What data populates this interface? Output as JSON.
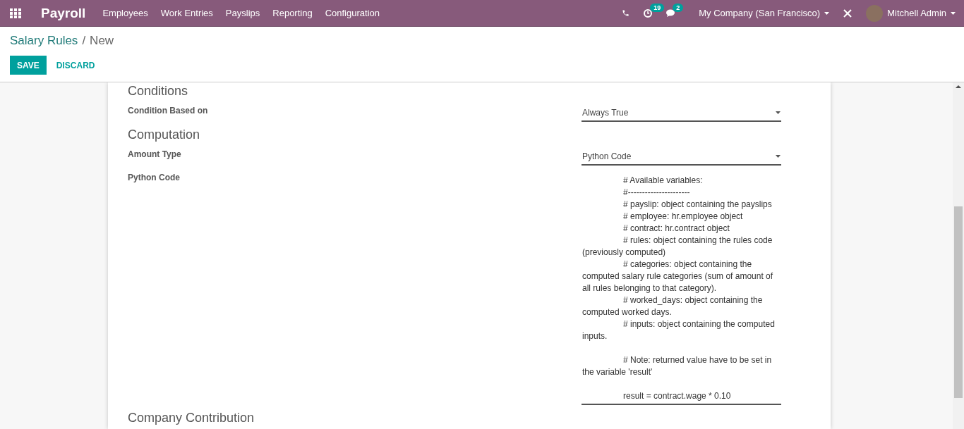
{
  "navbar": {
    "app_title": "Payroll",
    "menu": [
      "Employees",
      "Work Entries",
      "Payslips",
      "Reporting",
      "Configuration"
    ],
    "activity_count": "19",
    "message_count": "2",
    "company": "My Company (San Francisco)",
    "user": "Mitchell Admin"
  },
  "breadcrumb": {
    "parent": "Salary Rules",
    "separator": "/",
    "current": "New"
  },
  "buttons": {
    "save": "SAVE",
    "discard": "DISCARD"
  },
  "sections": [
    {
      "title": "Conditions",
      "fields": [
        {
          "kind": "select",
          "label": "Condition Based on",
          "value": "Always True"
        }
      ]
    },
    {
      "title": "Computation",
      "fields": [
        {
          "kind": "select",
          "label": "Amount Type",
          "value": "Python Code"
        },
        {
          "kind": "code",
          "label": "Python Code",
          "paragraphs": [
            [
              "# Available variables:",
              "#----------------------",
              "# payslip: object containing the payslips",
              "# employee: hr.employee object",
              "# contract: hr.contract object",
              "# rules: object containing the rules code (previously computed)",
              "# categories: object containing the computed salary rule categories (sum of amount of all rules belonging to that category).",
              "# worked_days: object containing the computed worked days.",
              "# inputs: object containing the computed inputs."
            ],
            [
              "# Note: returned value have to be set in the variable 'result'"
            ],
            [
              "result = contract.wage * 0.10"
            ]
          ]
        }
      ]
    },
    {
      "title": "Company Contribution"
    }
  ]
}
